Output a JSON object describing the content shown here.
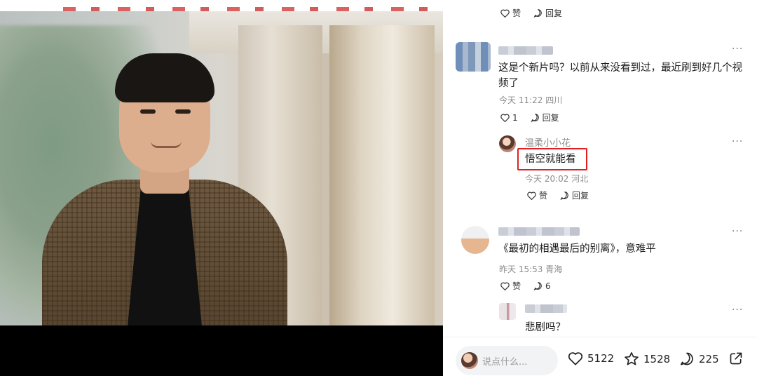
{
  "comments": [
    {
      "top_actions": {
        "like_label": "赞",
        "reply_label": "回复"
      }
    },
    {
      "text": "这是个新片吗？以前从来没看到过，最近刷到好几个视频了",
      "time": "今天 11:22 四川",
      "like_count": "1",
      "reply_label": "回复",
      "more": "···",
      "reply": {
        "username": "温柔小小花",
        "text": "悟空就能看",
        "time": "今天 20:02 河北",
        "like_label": "赞",
        "reply_label": "回复",
        "more": "···"
      }
    },
    {
      "text": "《最初的相遇最后的别离》，意难平",
      "time": "昨天 15:53 青海",
      "like_label": "赞",
      "reply_count": "6",
      "more": "···",
      "reply": {
        "text": "悲剧吗？",
        "more": "···"
      }
    }
  ],
  "bottom_bar": {
    "input_placeholder": "说点什么...",
    "likes": "5122",
    "favorites": "1528",
    "comments": "225"
  },
  "colors": {
    "highlight_box": "#e02020",
    "meta_text": "#8c8c8c"
  }
}
